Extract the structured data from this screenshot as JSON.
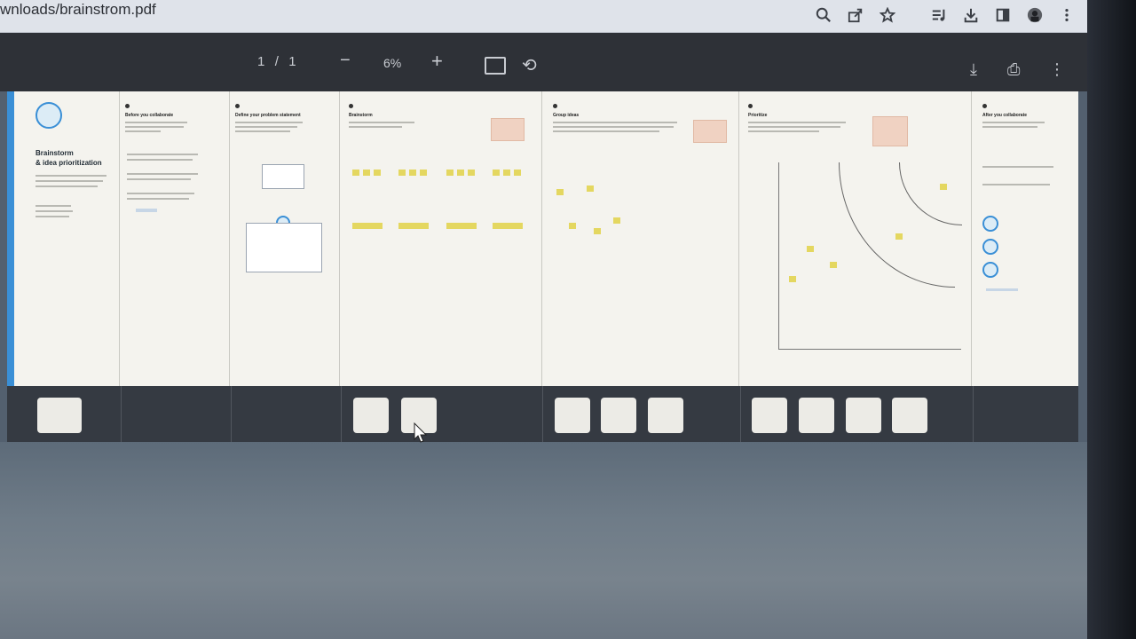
{
  "browser": {
    "url": "wnloads/brainstrom.pdf",
    "icons": [
      "search-icon",
      "share-icon",
      "star-icon",
      "media-icon",
      "download-icon",
      "sidebar-icon",
      "profile-icon",
      "menu-icon"
    ]
  },
  "pdf_toolbar": {
    "page_current": "1",
    "page_sep": "/",
    "page_total": "1",
    "zoom_out": "−",
    "zoom": "6%",
    "zoom_in": "+",
    "rotate": "⟲",
    "download": "⤓",
    "print": "⎙",
    "more": "⋮"
  },
  "board": {
    "title_line1": "Brainstorm",
    "title_line2": "& idea prioritization",
    "sections": [
      "Before you collaborate",
      "Define your problem statement",
      "Brainstorm",
      "Group ideas",
      "Prioritize",
      "After you collaborate"
    ]
  },
  "colors": {
    "accent": "#3a8fd6",
    "sticky": "#e4d760",
    "toolbar": "#2e3137"
  }
}
